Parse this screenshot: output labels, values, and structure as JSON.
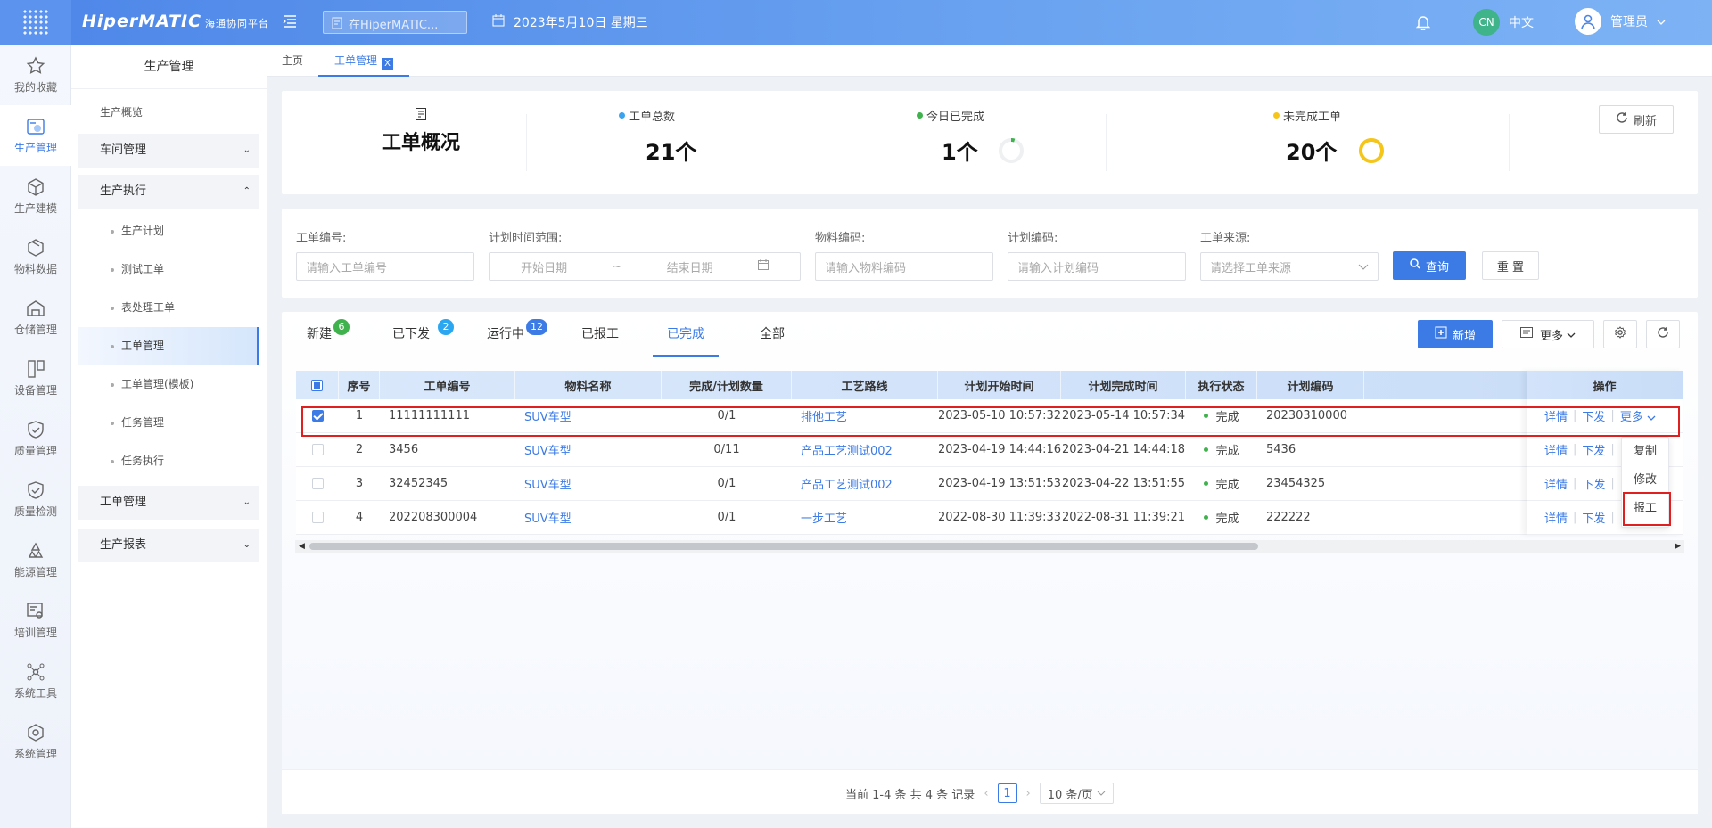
{
  "app": {
    "brand": "HiperMATIC",
    "brand_sub": "海通协同平台",
    "search_placeholder": "在HiperMATIC...",
    "date": "2023年5月10日 星期三",
    "lang_badge": "CN",
    "lang_label": "中文",
    "user": "管理员"
  },
  "rail": [
    {
      "label": "我的收藏",
      "icon": "star-icon"
    },
    {
      "label": "生产管理",
      "icon": "factory-icon",
      "active": true
    },
    {
      "label": "生产建模",
      "icon": "cube-icon"
    },
    {
      "label": "物料数据",
      "icon": "box-icon"
    },
    {
      "label": "仓储管理",
      "icon": "warehouse-icon"
    },
    {
      "label": "设备管理",
      "icon": "device-icon"
    },
    {
      "label": "质量管理",
      "icon": "shield-check-icon"
    },
    {
      "label": "质量检测",
      "icon": "shield-check-icon"
    },
    {
      "label": "能源管理",
      "icon": "recycle-icon"
    },
    {
      "label": "培训管理",
      "icon": "training-icon"
    },
    {
      "label": "系统工具",
      "icon": "network-icon"
    },
    {
      "label": "系统管理",
      "icon": "gear-cube-icon"
    }
  ],
  "subnav": {
    "title": "生产管理",
    "overview": "生产概览",
    "groups": {
      "workshop": "车间管理",
      "execution": "生产执行",
      "workorder": "工单管理",
      "report": "生产报表"
    },
    "children": [
      "生产计划",
      "测试工单",
      "表处理工单",
      "工单管理",
      "工单管理(模板)",
      "任务管理",
      "任务执行"
    ]
  },
  "pagetabs": {
    "home": "主页",
    "current": "工单管理",
    "close": "X"
  },
  "overview": {
    "title": "工单概况",
    "total_label": "工单总数",
    "total_value": "21个",
    "done_label": "今日已完成",
    "done_value": "1个",
    "done_ratio": 0.05,
    "undone_label": "未完成工单",
    "undone_value": "20个",
    "undone_ratio": 1.0,
    "refresh": "刷新",
    "colors": {
      "total": "#3aa3f0",
      "done": "#3fb14d",
      "undone": "#f5c518"
    }
  },
  "filters": {
    "order_no": {
      "label": "工单编号:",
      "placeholder": "请输入工单编号"
    },
    "time_range": {
      "label": "计划时间范围:",
      "start": "开始日期",
      "sep": "~",
      "end": "结束日期"
    },
    "material": {
      "label": "物料编码:",
      "placeholder": "请输入物料编码"
    },
    "plan": {
      "label": "计划编码:",
      "placeholder": "请输入计划编码"
    },
    "source": {
      "label": "工单来源:",
      "placeholder": "请选择工单来源"
    },
    "query": "查询",
    "reset": "重 置"
  },
  "status_tabs": [
    {
      "label": "新建",
      "badge": "6",
      "badge_color": "#3fb14d"
    },
    {
      "label": "已下发",
      "badge": "2",
      "badge_color": "#2aa7f0"
    },
    {
      "label": "运行中",
      "badge": "12",
      "badge_color": "#3c7be6"
    },
    {
      "label": "已报工",
      "badge": ""
    },
    {
      "label": "已完成",
      "badge": "",
      "active": true
    },
    {
      "label": "全部",
      "badge": ""
    }
  ],
  "toolbar": {
    "add": "新增",
    "more": "更多"
  },
  "table": {
    "headers": [
      "序号",
      "工单编号",
      "物料名称",
      "完成/计划数量",
      "工艺路线",
      "计划开始时间",
      "计划完成时间",
      "执行状态",
      "计划编码",
      "操作"
    ],
    "rows": [
      {
        "idx": "1",
        "no": "11111111111",
        "material": "SUV车型",
        "qty": "0/1",
        "route": "排他工艺",
        "start": "2023-05-10 10:57:32",
        "end": "2023-05-14 10:57:34",
        "status": "完成",
        "plan": "20230310000",
        "checked": true
      },
      {
        "idx": "2",
        "no": "3456",
        "material": "SUV车型",
        "qty": "0/11",
        "route": "产品工艺测试002",
        "start": "2023-04-19 14:44:16",
        "end": "2023-04-21 14:44:18",
        "status": "完成",
        "plan": "5436",
        "checked": false
      },
      {
        "idx": "3",
        "no": "32452345",
        "material": "SUV车型",
        "qty": "0/1",
        "route": "产品工艺测试002",
        "start": "2023-04-19 13:51:53",
        "end": "2023-04-22 13:51:55",
        "status": "完成",
        "plan": "23454325",
        "checked": false
      },
      {
        "idx": "4",
        "no": "202208300004",
        "material": "SUV车型",
        "qty": "0/1",
        "route": "一步工艺",
        "start": "2022-08-30 11:39:33",
        "end": "2022-08-31 11:39:21",
        "status": "完成",
        "plan": "222222",
        "checked": false
      }
    ],
    "ops": {
      "detail": "详情",
      "issue": "下发",
      "more": "更多"
    }
  },
  "dropdown": [
    "复制",
    "修改",
    "报工"
  ],
  "pagination": {
    "summary": "当前 1-4 条 共 4 条 记录",
    "page": "1",
    "size": "10 条/页"
  }
}
